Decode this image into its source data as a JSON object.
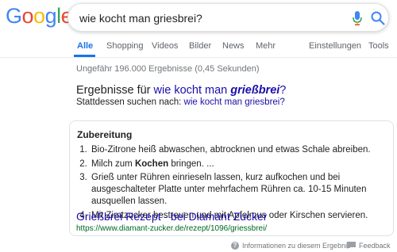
{
  "header": {
    "logo_letters": [
      {
        "ch": "G",
        "color": "#4285F4"
      },
      {
        "ch": "o",
        "color": "#EA4335"
      },
      {
        "ch": "o",
        "color": "#FBBC05"
      },
      {
        "ch": "g",
        "color": "#4285F4"
      },
      {
        "ch": "l",
        "color": "#34A853"
      },
      {
        "ch": "e",
        "color": "#EA4335"
      }
    ],
    "search_value": "wie kocht man griesbrei?"
  },
  "tabs": {
    "all": "Alle",
    "shopping": "Shopping",
    "videos": "Videos",
    "images": "Bilder",
    "news": "News",
    "more": "Mehr",
    "settings": "Einstellungen",
    "tools": "Tools"
  },
  "stats": "Ungefähr 196.000 Ergebnisse (0,45 Sekunden)",
  "correction": {
    "prefix": "Ergebnisse für ",
    "query_start": "wie kocht man ",
    "query_bold": "grießbrei",
    "query_end": "?",
    "instead_prefix": "Stattdessen suchen nach: ",
    "instead_query": "wie kocht man griesbrei?"
  },
  "snippet": {
    "title": "Zubereitung",
    "steps": [
      {
        "text": "Bio-Zitrone heiß abwaschen, abtrocknen und etwas Schale abreiben."
      },
      {
        "before": "Milch zum ",
        "bold": "Kochen",
        "after": " bringen. ..."
      },
      {
        "text": "Grieß unter Rühren einrieseln lassen, kurz aufkochen und bei ausgeschalteter Platte unter mehrfachem Rühren ca. 10-15 Minuten ausquellen lassen."
      },
      {
        "text": "Mit Zimtzucker bestreuen und mit Apfelmus oder Kirschen servieren."
      }
    ],
    "link_title": "Grießbrei Rezept - bei Diamant Zucker",
    "link_url": "https://www.diamant-zucker.de/rezept/1096/griessbrei/"
  },
  "footer": {
    "info_label": "Informationen zu diesem Ergebnis",
    "feedback_label": "Feedback"
  },
  "colors": {
    "accent": "#1a73e8",
    "link": "#1a0dab",
    "url": "#006621"
  },
  "icons": [
    "mic-icon",
    "search-icon",
    "info-icon",
    "feedback-icon"
  ]
}
